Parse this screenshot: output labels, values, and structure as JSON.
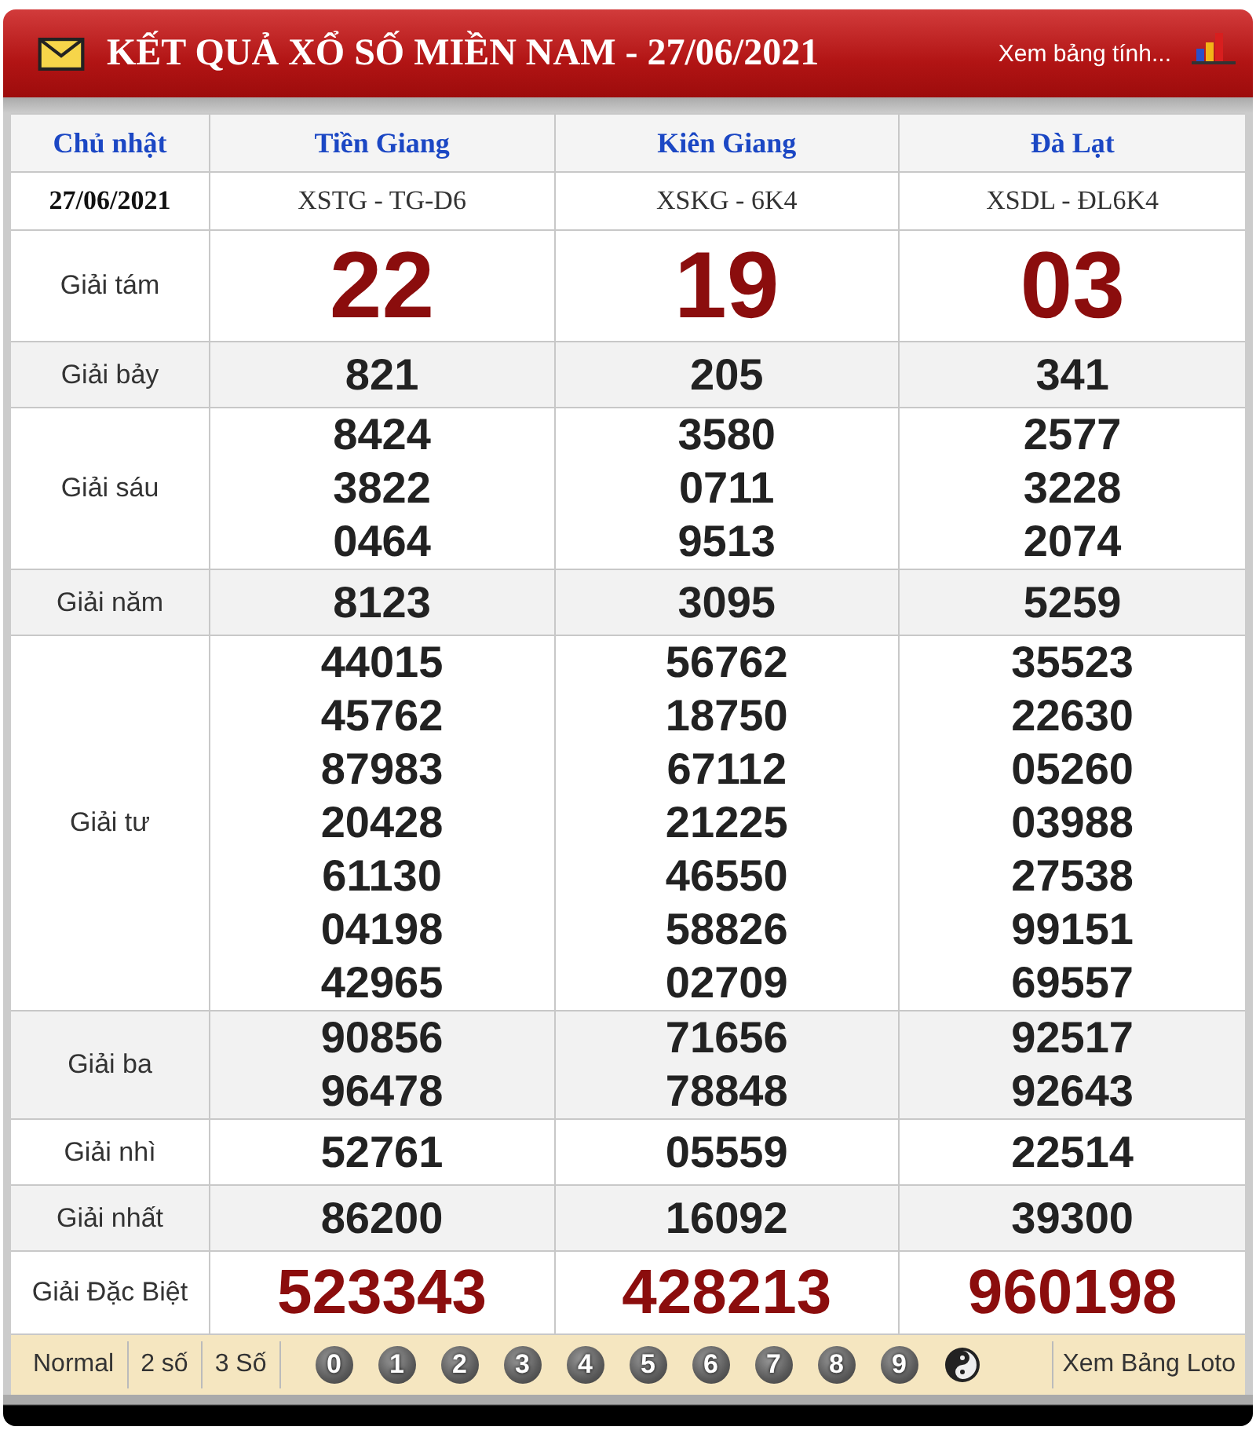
{
  "header": {
    "title": "KẾT QUẢ XỔ SỐ MIỀN NAM - 27/06/2021",
    "link": "Xem bảng tính..."
  },
  "table": {
    "day": "Chủ nhật",
    "date": "27/06/2021",
    "provinces": [
      {
        "name": "Tiền Giang",
        "code": "XSTG - TG-D6"
      },
      {
        "name": "Kiên Giang",
        "code": "XSKG - 6K4"
      },
      {
        "name": "Đà Lạt",
        "code": "XSDL - ĐL6K4"
      }
    ],
    "rows": [
      {
        "label": "Giải tám",
        "kind": "eighth",
        "cells": [
          [
            "22"
          ],
          [
            "19"
          ],
          [
            "03"
          ]
        ]
      },
      {
        "label": "Giải bảy",
        "kind": "normal",
        "cells": [
          [
            "821"
          ],
          [
            "205"
          ],
          [
            "341"
          ]
        ]
      },
      {
        "label": "Giải sáu",
        "kind": "normal",
        "cells": [
          [
            "8424",
            "3822",
            "0464"
          ],
          [
            "3580",
            "0711",
            "9513"
          ],
          [
            "2577",
            "3228",
            "2074"
          ]
        ]
      },
      {
        "label": "Giải năm",
        "kind": "normal",
        "cells": [
          [
            "8123"
          ],
          [
            "3095"
          ],
          [
            "5259"
          ]
        ]
      },
      {
        "label": "Giải tư",
        "kind": "normal",
        "cells": [
          [
            "44015",
            "45762",
            "87983",
            "20428",
            "61130",
            "04198",
            "42965"
          ],
          [
            "56762",
            "18750",
            "67112",
            "21225",
            "46550",
            "58826",
            "02709"
          ],
          [
            "35523",
            "22630",
            "05260",
            "03988",
            "27538",
            "99151",
            "69557"
          ]
        ]
      },
      {
        "label": "Giải ba",
        "kind": "normal",
        "cells": [
          [
            "90856",
            "96478"
          ],
          [
            "71656",
            "78848"
          ],
          [
            "92517",
            "92643"
          ]
        ]
      },
      {
        "label": "Giải nhì",
        "kind": "normal",
        "cells": [
          [
            "52761"
          ],
          [
            "05559"
          ],
          [
            "22514"
          ]
        ]
      },
      {
        "label": "Giải nhất",
        "kind": "normal",
        "cells": [
          [
            "86200"
          ],
          [
            "16092"
          ],
          [
            "39300"
          ]
        ]
      },
      {
        "label": "Giải Đặc Biệt",
        "kind": "special",
        "cells": [
          [
            "523343"
          ],
          [
            "428213"
          ],
          [
            "960198"
          ]
        ]
      }
    ]
  },
  "toolbar": {
    "modes": [
      "Normal",
      "2 số",
      "3 Số"
    ],
    "digits": [
      "0",
      "1",
      "2",
      "3",
      "4",
      "5",
      "6",
      "7",
      "8",
      "9"
    ],
    "link": "Xem Bảng Loto"
  }
}
